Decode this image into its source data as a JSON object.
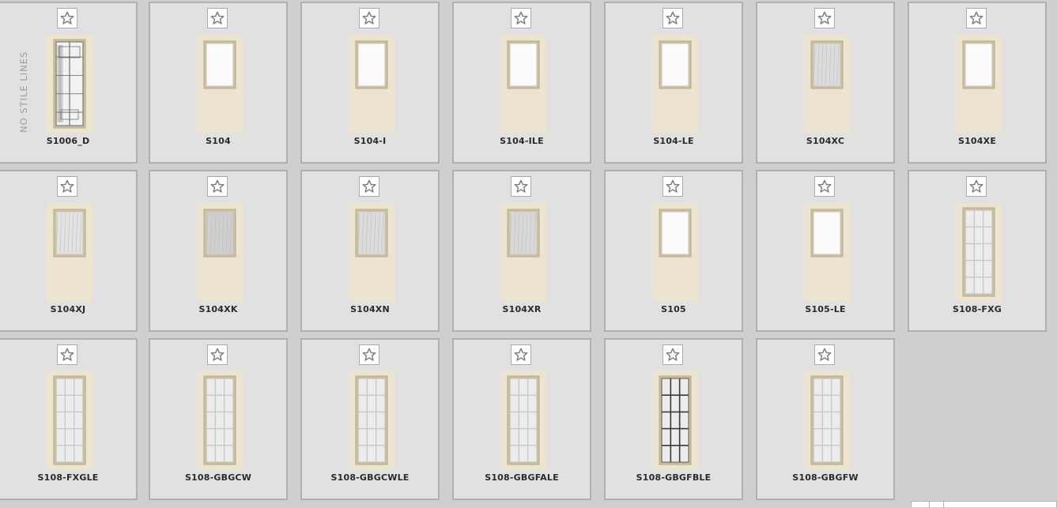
{
  "side_note": "NO STILE LINES",
  "products": [
    {
      "code": "S1006_D",
      "glass": "decorative"
    },
    {
      "code": "S104",
      "glass": "clear"
    },
    {
      "code": "S104-I",
      "glass": "clear"
    },
    {
      "code": "S104-ILE",
      "glass": "clear"
    },
    {
      "code": "S104-LE",
      "glass": "clear"
    },
    {
      "code": "S104XC",
      "glass": "textured"
    },
    {
      "code": "S104XE",
      "glass": "clear"
    },
    {
      "code": "S104XJ",
      "glass": "rain"
    },
    {
      "code": "S104XK",
      "glass": "smoked"
    },
    {
      "code": "S104XN",
      "glass": "textured"
    },
    {
      "code": "S104XR",
      "glass": "cloudy"
    },
    {
      "code": "S105",
      "glass": "clear"
    },
    {
      "code": "S105-LE",
      "glass": "clear"
    },
    {
      "code": "S108-FXG",
      "glass": "grid-full"
    },
    {
      "code": "S108-FXGLE",
      "glass": "grid-full"
    },
    {
      "code": "S108-GBGCW",
      "glass": "grid-full"
    },
    {
      "code": "S108-GBGCWLE",
      "glass": "grid-full"
    },
    {
      "code": "S108-GBGFALE",
      "glass": "grid-full"
    },
    {
      "code": "S108-GBGFBLE",
      "glass": "grid-dark"
    },
    {
      "code": "S108-GBGFW",
      "glass": "grid-full"
    }
  ],
  "icons": {
    "favorite": "star-outline-icon"
  },
  "colors": {
    "card_bg": "#e1e1e1",
    "card_border": "#b0b0b0",
    "door": "#ece4cf",
    "page_bg": "#cfcfcf"
  }
}
